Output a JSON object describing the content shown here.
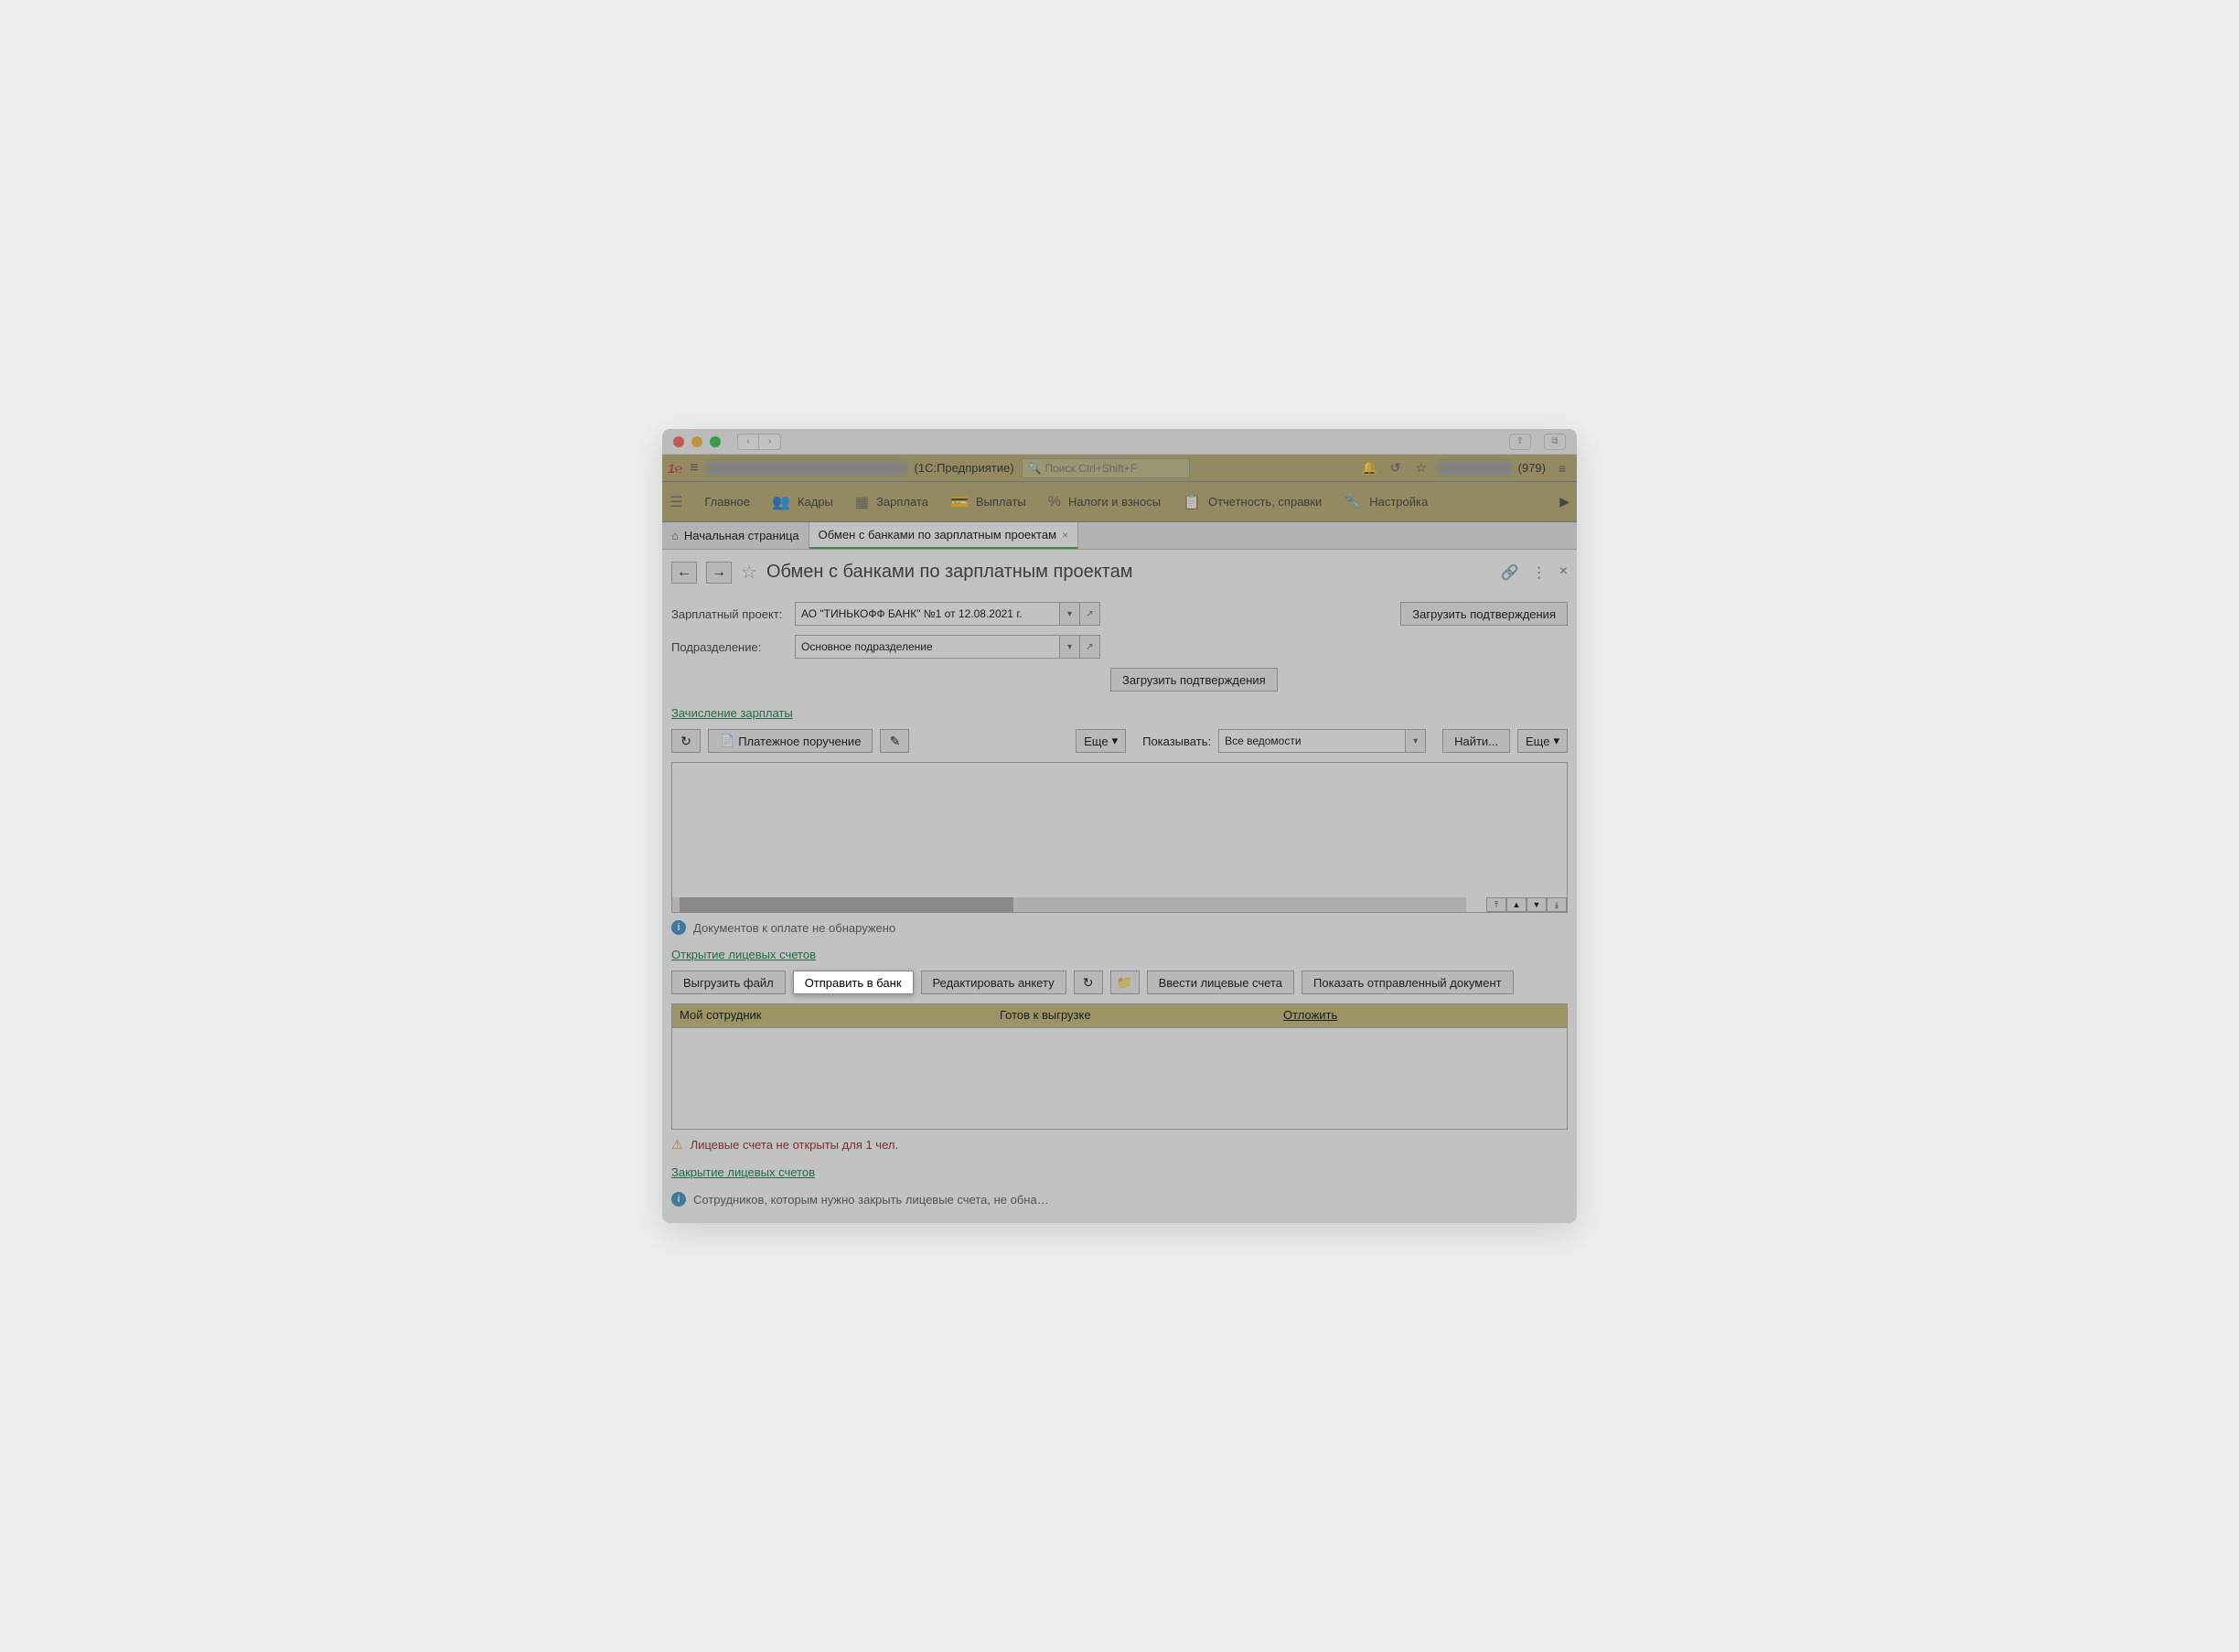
{
  "app": {
    "suffix": "(1С:Предприятие)",
    "search_placeholder": "Поиск Ctrl+Shift+F",
    "user_count": "(979)"
  },
  "nav": {
    "items": [
      "Главное",
      "Кадры",
      "Зарплата",
      "Выплаты",
      "Налоги и взносы",
      "Отчетность, справки",
      "Настройка"
    ]
  },
  "tabs": {
    "home": "Начальная страница",
    "active": "Обмен с банками по зарплатным проектам"
  },
  "page": {
    "title": "Обмен с банками по зарплатным проектам"
  },
  "form": {
    "project_label": "Зарплатный проект:",
    "project_value": "АО \"ТИНЬКОФФ БАНК\" №1 от 12.08.2021 г.",
    "dept_label": "Подразделение:",
    "dept_value": "Основное подразделение",
    "load_confirm": "Загрузить подтверждения"
  },
  "section_salary": {
    "link": "Зачисление зарплаты",
    "payment_order": "Платежное поручение",
    "more": "Еще",
    "show_label": "Показывать:",
    "show_value": "Все ведомости",
    "find": "Найти...",
    "status": "Документов к оплате не обнаружено"
  },
  "section_accounts": {
    "link": "Открытие лицевых счетов",
    "export_file": "Выгрузить файл",
    "send_bank": "Отправить в банк",
    "edit_form": "Редактировать анкету",
    "enter_accounts": "Ввести лицевые счета",
    "show_sent": "Показать отправленный документ",
    "cols": {
      "c1": "Мой сотрудник",
      "c2": "Готов к выгрузке",
      "c3": "Отложить"
    },
    "warning": "Лицевые счета не открыты для 1 чел."
  },
  "section_close": {
    "link": "Закрытие лицевых счетов",
    "status": "Сотрудников, которым нужно закрыть лицевые счета, не обна…"
  }
}
